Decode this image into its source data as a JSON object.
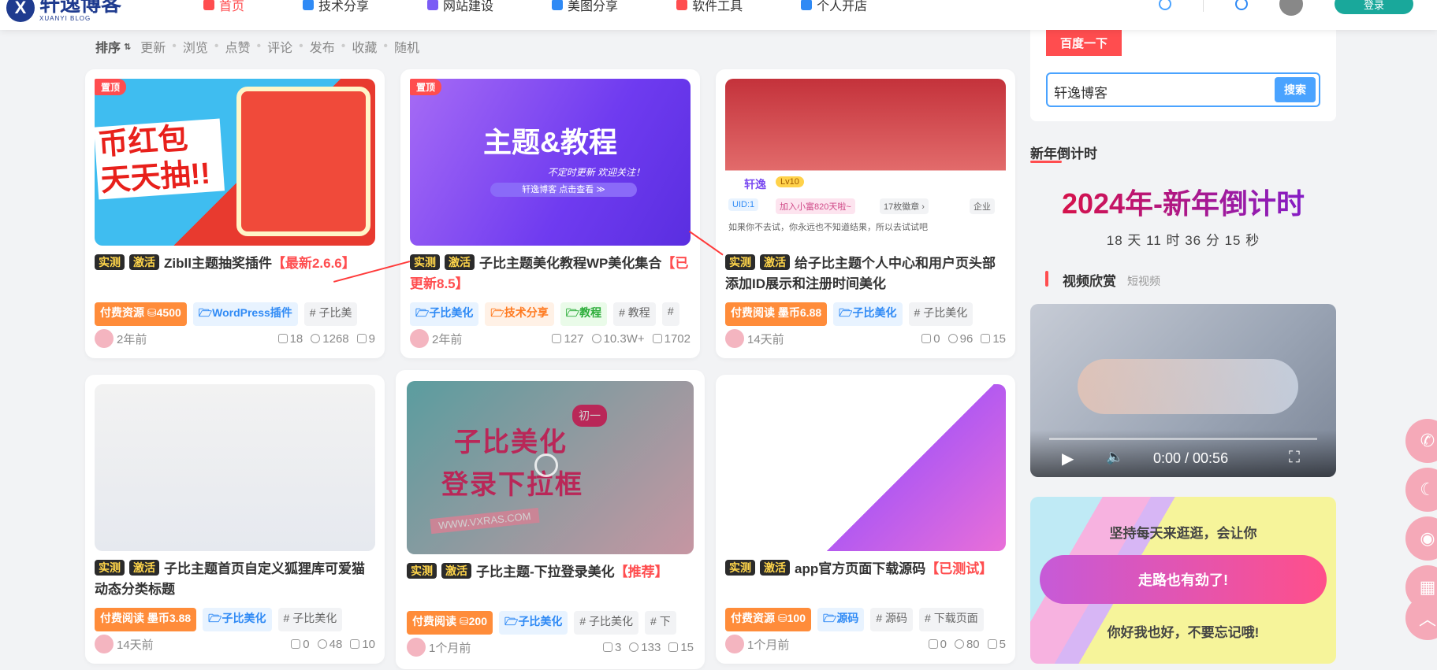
{
  "site": {
    "logo_text": "轩逸博客",
    "logo_sub": "XUANYI BLOG"
  },
  "nav": [
    {
      "label": "首页",
      "color": "#ff4d4f",
      "active": true
    },
    {
      "label": "技术分享",
      "color": "#2f8af5"
    },
    {
      "label": "网站建设",
      "color": "#7b5cf5"
    },
    {
      "label": "美图分享",
      "color": "#2f8af5"
    },
    {
      "label": "软件工具",
      "color": "#ff4d4f"
    },
    {
      "label": "个人开店",
      "color": "#2f8af5"
    }
  ],
  "topright": {
    "button": "登录"
  },
  "sort": {
    "label": "排序",
    "items": [
      "更新",
      "浏览",
      "点赞",
      "评论",
      "发布",
      "收藏",
      "随机"
    ]
  },
  "cards": [
    {
      "pin": "置顶",
      "tags_title": [
        "实测",
        "激活"
      ],
      "title": "Zibll主题抽奖插件",
      "title_red": "【最新2.6.6】",
      "tags": [
        {
          "text": "付费资源 ⛁4500",
          "cls": "t-pay"
        },
        {
          "text": "🗁WordPress插件",
          "cls": "t-blue"
        },
        {
          "text": "# 子比美",
          "cls": "t-gray"
        }
      ],
      "time": "2年前",
      "comments": "18",
      "views": "1268",
      "likes": "9"
    },
    {
      "pin": "置顶",
      "tags_title": [
        "实测",
        "激活"
      ],
      "title": "子比主题美化教程WP美化集合",
      "title_red": "【已更新8.5】",
      "tags": [
        {
          "text": "🗁子比美化",
          "cls": "t-blue"
        },
        {
          "text": "🗁技术分享",
          "cls": "t-orange"
        },
        {
          "text": "🗁教程",
          "cls": "t-green"
        },
        {
          "text": "# 教程",
          "cls": "t-gray"
        },
        {
          "text": "#",
          "cls": "t-gray"
        }
      ],
      "time": "2年前",
      "comments": "127",
      "views": "10.3W+",
      "likes": "1702"
    },
    {
      "pin": "",
      "tags_title": [
        "实测",
        "激活"
      ],
      "title": "给子比主题个人中心和用户页头部添加ID展示和注册时间美化",
      "title_red": "",
      "tags": [
        {
          "text": "付费阅读 墨币6.88",
          "cls": "t-pay"
        },
        {
          "text": "🗁子比美化",
          "cls": "t-blue"
        },
        {
          "text": "# 子比美化",
          "cls": "t-gray"
        }
      ],
      "time": "14天前",
      "comments": "0",
      "views": "96",
      "likes": "15"
    },
    {
      "pin": "",
      "tags_title": [
        "实测",
        "激活"
      ],
      "title": "子比主题首页自定义狐狸库可爱猫动态分类标题",
      "title_red": "",
      "tags": [
        {
          "text": "付费阅读 墨币3.88",
          "cls": "t-pay"
        },
        {
          "text": "🗁子比美化",
          "cls": "t-blue"
        },
        {
          "text": "# 子比美化",
          "cls": "t-gray"
        }
      ],
      "time": "14天前",
      "comments": "0",
      "views": "48",
      "likes": "10"
    },
    {
      "pin": "",
      "tags_title": [
        "实测",
        "激活"
      ],
      "title": "子比主题-下拉登录美化",
      "title_red": "【推荐】",
      "tags": [
        {
          "text": "付费阅读 ⛁200",
          "cls": "t-pay"
        },
        {
          "text": "🗁子比美化",
          "cls": "t-blue"
        },
        {
          "text": "# 子比美化",
          "cls": "t-gray"
        },
        {
          "text": "# 下",
          "cls": "t-gray"
        }
      ],
      "time": "1个月前",
      "comments": "3",
      "views": "133",
      "likes": "15"
    },
    {
      "pin": "",
      "tags_title": [
        "实测",
        "激活"
      ],
      "title": "app官方页面下载源码",
      "title_red": "【已测试】",
      "tags": [
        {
          "text": "付费资源 ⛁100",
          "cls": "t-pay"
        },
        {
          "text": "🗁源码",
          "cls": "t-blue"
        },
        {
          "text": "# 源码",
          "cls": "t-gray"
        },
        {
          "text": "# 下载页面",
          "cls": "t-gray"
        }
      ],
      "time": "1个月前",
      "comments": "0",
      "views": "80",
      "likes": "5"
    }
  ],
  "thumbs": {
    "c1": "币红包 天天抽!!",
    "c2_title": "主题&教程",
    "c2_sub": "不定时更新  欢迎关注！",
    "c2_btn": "轩逸博客 点击查看 ≫",
    "c3_name": "轩逸",
    "c3_lv": "Lv10",
    "c3_uid": "UID:1",
    "c3_join": "加入小富820天啦~",
    "c3_medal": "17枚徽章 ›",
    "c3_ent": "企业",
    "c3_motto": "如果你不去试，你永远也不知道结果，所以去试试吧",
    "c5_text1": "子比美化",
    "c5_text2": "登录下拉框",
    "c5_badge": "初一",
    "c5_url": "WWW.VXRAS.COM"
  },
  "sidebar": {
    "baidu_btn": "百度一下",
    "search_value": "轩逸博客",
    "search_btn": "搜索",
    "countdown_title": "新年倒计时",
    "countdown_head": "2024年-新年倒计时",
    "countdown_time": "18 天 11 时 36 分 15 秒",
    "video_title": "视频欣赏",
    "video_sub": "短视频",
    "video_time": "0:00 / 00:56",
    "promo_top": "坚持每天来逛逛，会让你",
    "promo_btn": "走路也有劲了!",
    "promo_bottom": "你好我也好，不要忘记哦!"
  },
  "float_icons": [
    "phone-icon",
    "moon-icon",
    "qq-icon",
    "qrcode-icon",
    "up-arrow-icon"
  ]
}
